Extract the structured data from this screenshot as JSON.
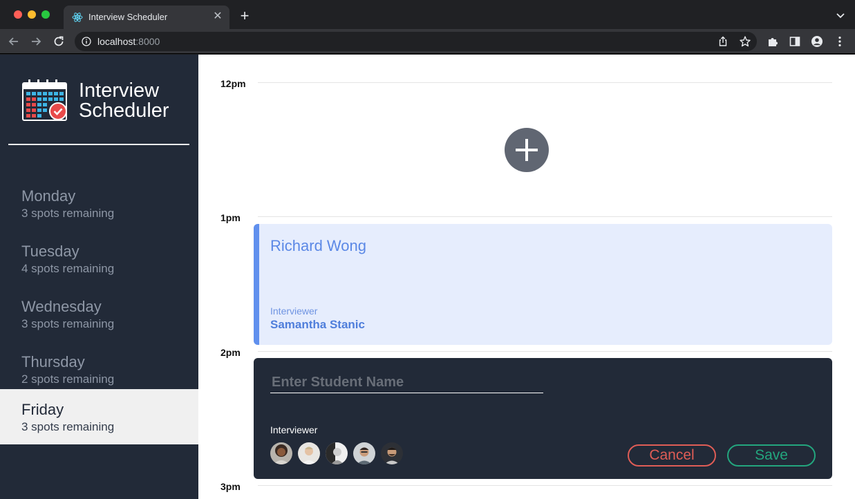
{
  "browser": {
    "tab_title": "Interview Scheduler",
    "url_host": "localhost",
    "url_port": ":8000"
  },
  "brand": {
    "line1": "Interview",
    "line2": "Scheduler"
  },
  "days": [
    {
      "name": "Monday",
      "spots": "3 spots remaining",
      "selected": false
    },
    {
      "name": "Tuesday",
      "spots": "4 spots remaining",
      "selected": false
    },
    {
      "name": "Wednesday",
      "spots": "3 spots remaining",
      "selected": false
    },
    {
      "name": "Thursday",
      "spots": "2 spots remaining",
      "selected": false
    },
    {
      "name": "Friday",
      "spots": "3 spots remaining",
      "selected": true
    }
  ],
  "schedule": {
    "hours": [
      "12pm",
      "1pm",
      "2pm",
      "3pm"
    ],
    "appointment": {
      "student": "Richard Wong",
      "interviewer_label": "Interviewer",
      "interviewer": "Samantha Stanic"
    },
    "form": {
      "student_placeholder": "Enter Student Name",
      "student_value": "",
      "interviewer_label": "Interviewer",
      "interviewer_count": 5,
      "cancel_label": "Cancel",
      "save_label": "Save"
    }
  },
  "colors": {
    "sidebar": "#222a38",
    "selected_day": "#f0f0f0",
    "appointment_bg": "#e6edfd",
    "appointment_accent": "#6090ee",
    "cancel": "#e05d56",
    "save": "#23a67e"
  }
}
